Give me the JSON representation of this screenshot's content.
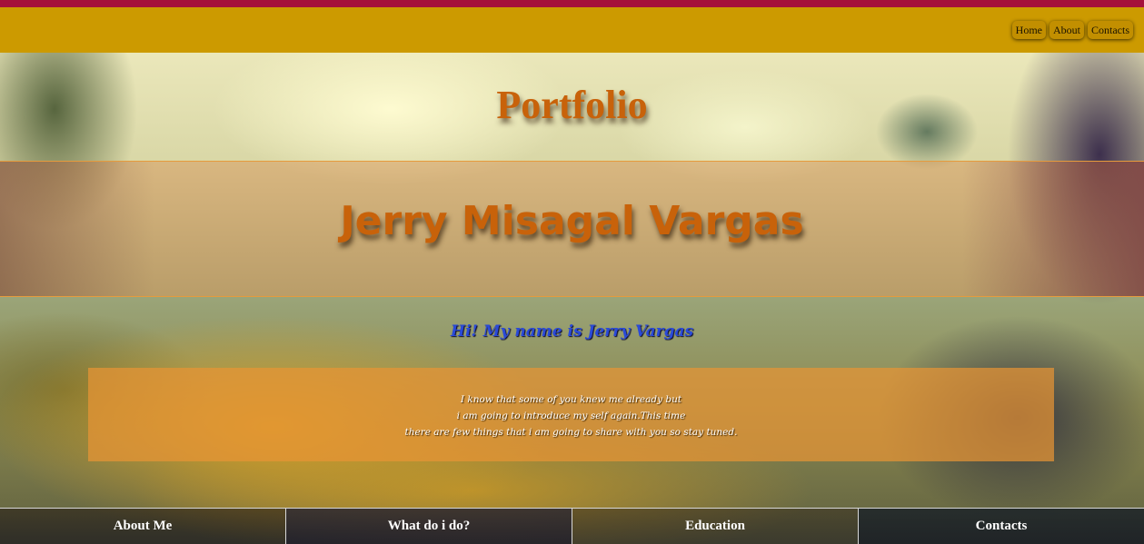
{
  "header": {
    "nav": [
      {
        "label": "Home"
      },
      {
        "label": "About"
      },
      {
        "label": "Contacts"
      }
    ]
  },
  "hero": {
    "title": "Portfolio",
    "name": "Jerry Misagal Vargas"
  },
  "intro": {
    "greeting": "Hi! My name is Jerry Vargas",
    "lines": [
      "I know that some of you knew me already but",
      "i am going to introduce my self again.This time",
      "there are few things that i am going to share with you so stay tuned."
    ]
  },
  "footer": {
    "items": [
      {
        "label": "About Me"
      },
      {
        "label": "What do i do?"
      },
      {
        "label": "Education"
      },
      {
        "label": "Contacts"
      }
    ]
  },
  "colors": {
    "top_stripe": "#a5103a",
    "navbar": "#cc9a00",
    "title": "#c8620a",
    "greeting": "#2a4ad8",
    "intro_box": "#e89434"
  }
}
